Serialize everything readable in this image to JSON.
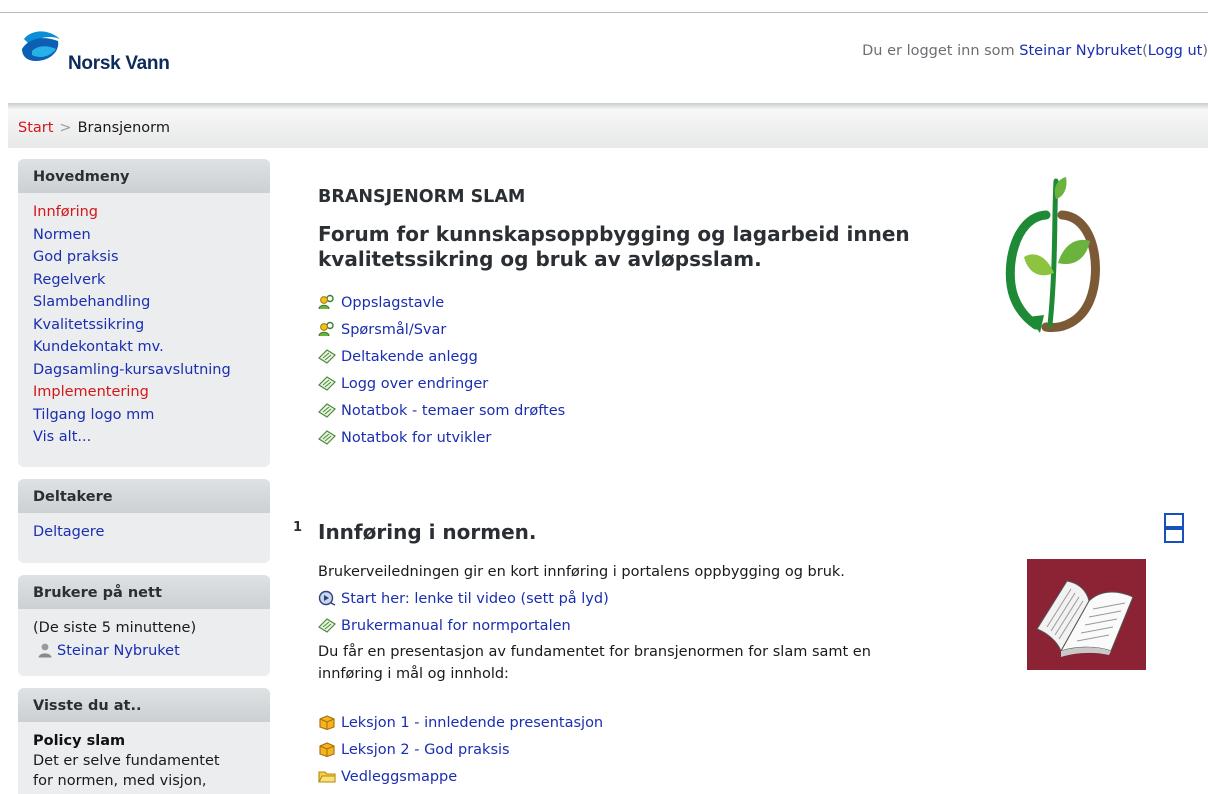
{
  "header": {
    "logo_text": "Norsk Vann",
    "login_prefix": "Du er logget inn som",
    "user_name": "Steinar Nybruket",
    "logout_label": "Logg ut"
  },
  "breadcrumb": {
    "start": "Start",
    "separator": ">",
    "current": "Bransjenorm"
  },
  "sidebar": {
    "main_menu": {
      "title": "Hovedmeny",
      "items": [
        {
          "label": "Innføring",
          "active": true
        },
        {
          "label": "Normen"
        },
        {
          "label": "God praksis"
        },
        {
          "label": "Regelverk"
        },
        {
          "label": "Slambehandling"
        },
        {
          "label": "Kvalitetssikring"
        },
        {
          "label": "Kundekontakt mv."
        },
        {
          "label": "Dagsamling-kursavslutning"
        },
        {
          "label": "Implementering",
          "active": true
        },
        {
          "label": "Tilgang logo mm"
        },
        {
          "label": "Vis alt..."
        }
      ]
    },
    "participants": {
      "title": "Deltakere",
      "items": [
        {
          "label": "Deltagere"
        }
      ]
    },
    "online": {
      "title": "Brukere på nett",
      "note": "(De siste 5 minuttene)",
      "user": "Steinar Nybruket"
    },
    "did_you_know": {
      "title": "Visste du at..",
      "heading": "Policy slam",
      "text_line1": "Det er selve fundamentet",
      "text_line2": "for normen, med visjon,"
    }
  },
  "main": {
    "title": "BRANSJENORM SLAM",
    "subtitle": "Forum for kunnskapsoppbygging og lagarbeid innen kvalitetssikring og bruk av avløpsslam.",
    "forum_links": [
      {
        "label": "Oppslagstavle",
        "icon": "people-icon"
      },
      {
        "label": "Spørsmål/Svar",
        "icon": "people-icon"
      },
      {
        "label": "Deltakende anlegg",
        "icon": "notepad-icon"
      },
      {
        "label": "Logg over endringer",
        "icon": "notepad-icon"
      },
      {
        "label": "Notatbok - temaer som drøftes",
        "icon": "notepad-icon"
      },
      {
        "label": "Notatbok for utvikler",
        "icon": "notepad-icon"
      }
    ],
    "section": {
      "number": "1",
      "title": "Innføring i normen.",
      "intro": "Brukerveiledningen gir en kort innføring i portalens oppbygging og bruk.",
      "video_link": "Start her: lenke til video (sett på lyd)",
      "manual_link": "Brukermanual for normportalen",
      "para_line1": "Du får en presentasjon av fundamentet for bransjenormen for slam samt en",
      "para_line2": "innføring i mål og innhold:",
      "lessons": [
        {
          "label": "Leksjon 1 - innledende presentasjon",
          "icon": "package-icon"
        },
        {
          "label": "Leksjon 2 - God praksis",
          "icon": "package-icon"
        },
        {
          "label": "Vedleggsmappe",
          "icon": "folder-icon"
        }
      ]
    }
  },
  "colors": {
    "link": "#1a2eb0",
    "active_link": "#d4171a",
    "sidebar_bg": "#ebedee",
    "book_bg": "#8b2335"
  }
}
